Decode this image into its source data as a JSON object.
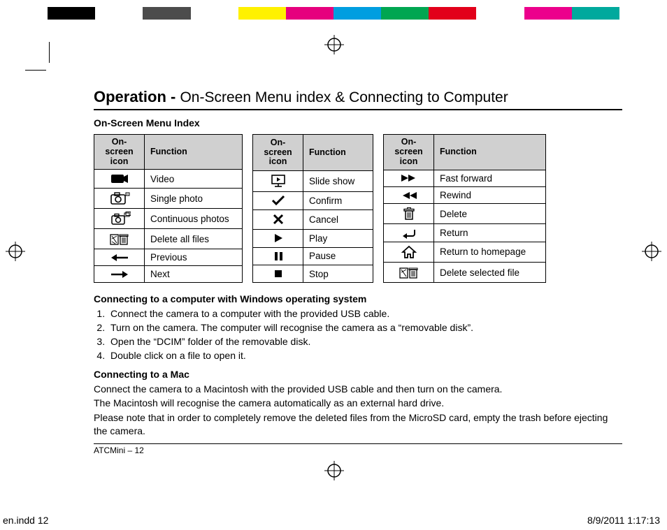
{
  "title": {
    "bold": "Operation - ",
    "rest": "On-Screen Menu index & Connecting to Computer"
  },
  "subhead1": "On-Screen Menu Index",
  "header": {
    "icon": "On-screen\nicon",
    "func": "Function"
  },
  "table1": [
    {
      "icon": "video-icon",
      "label": "Video"
    },
    {
      "icon": "single-photo-icon",
      "label": "Single photo"
    },
    {
      "icon": "cont-photos-icon",
      "label": "Continuous photos"
    },
    {
      "icon": "delete-all-icon",
      "label": "Delete all files"
    },
    {
      "icon": "previous-icon",
      "label": "Previous"
    },
    {
      "icon": "next-icon",
      "label": "Next"
    }
  ],
  "table2": [
    {
      "icon": "slideshow-icon",
      "label": "Slide show"
    },
    {
      "icon": "confirm-icon",
      "label": "Confirm"
    },
    {
      "icon": "cancel-icon",
      "label": "Cancel"
    },
    {
      "icon": "play-icon",
      "label": "Play"
    },
    {
      "icon": "pause-icon",
      "label": "Pause"
    },
    {
      "icon": "stop-icon",
      "label": "Stop"
    }
  ],
  "table3": [
    {
      "icon": "fast-forward-icon",
      "label": "Fast forward"
    },
    {
      "icon": "rewind-icon",
      "label": "Rewind"
    },
    {
      "icon": "delete-icon",
      "label": "Delete"
    },
    {
      "icon": "return-icon",
      "label": "Return"
    },
    {
      "icon": "home-icon",
      "label": "Return to homepage"
    },
    {
      "icon": "delete-selected-icon",
      "label": "Delete selected file"
    }
  ],
  "sectionWin": {
    "heading": "Connecting to a computer with Windows operating system",
    "steps": [
      "Connect the camera to a computer with the provided USB cable.",
      "Turn on the camera. The computer will recognise the camera as a “removable disk”.",
      "Open the “DCIM” folder of the removable disk.",
      "Double click on a file to open it."
    ]
  },
  "sectionMac": {
    "heading": "Connecting to a Mac",
    "lines": [
      "Connect the camera to a Macintosh with the provided USB cable and then turn on the camera.",
      "The Macintosh will recognise the camera automatically as an external hard drive.",
      "Please note that in order to completely remove the deleted files from the MicroSD card, empty the trash before ejecting the camera."
    ]
  },
  "footline": "ATCMini  –  12",
  "printfoot": {
    "left": "en.indd   12",
    "right": "8/9/2011   1:17:13"
  }
}
